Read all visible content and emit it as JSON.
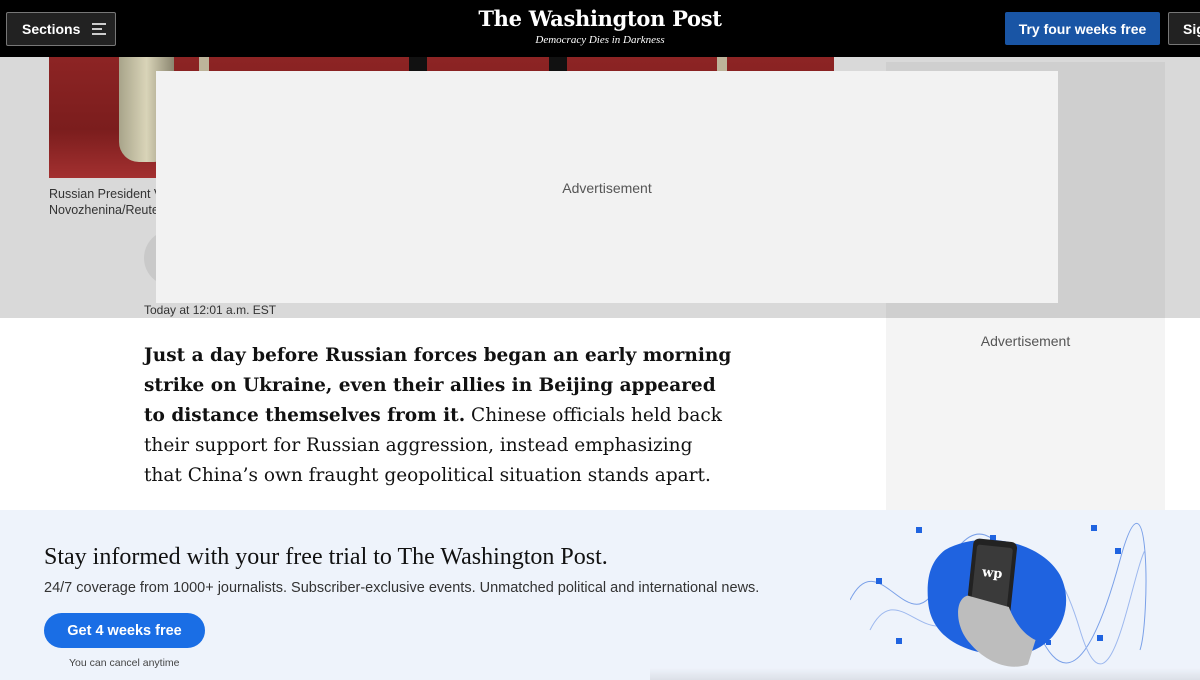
{
  "header": {
    "sections_label": "Sections",
    "logo_name": "The Washington Post",
    "logo_tagline": "Democracy Dies in Darkness",
    "trial_button": "Try four weeks free",
    "signin_button": "Sign in"
  },
  "article": {
    "photo_caption_line1": "Russian President V",
    "photo_caption_line2": "Novozhenina/Reute",
    "timestamp": "Today at 12:01 a.m. EST",
    "lede_bold": "Just a day before Russian forces began an early morning strike on Ukraine, even their allies in Beijing appeared to distance themselves from it.",
    "lede_rest": " Chinese officials held back their support for Russian aggression, instead emphasizing that China’s own fraught geopolitical situation stands apart."
  },
  "ads": {
    "overlay_label": "Advertisement",
    "rail_label": "Advertisement"
  },
  "banner": {
    "title": "Stay informed with your free trial to The Washington Post.",
    "subtitle": "24/7 coverage from 1000+ journalists. Subscriber-exclusive events. Unmatched political and international news.",
    "cta": "Get 4 weeks free",
    "note": "You can cancel anytime",
    "phone_logo": "wp"
  },
  "colors": {
    "header_bg": "#000000",
    "trial_button_bg": "#1955a5",
    "cta_bg": "#1a6ee5",
    "banner_bg": "#eef3fb",
    "illustration_blob": "#1f63e0"
  }
}
